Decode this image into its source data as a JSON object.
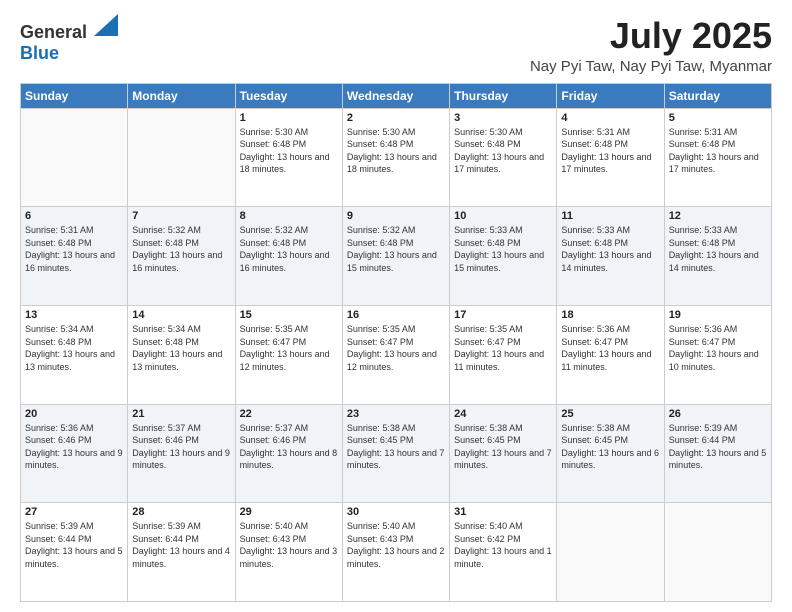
{
  "header": {
    "logo_general": "General",
    "logo_blue": "Blue",
    "month": "July 2025",
    "location": "Nay Pyi Taw, Nay Pyi Taw, Myanmar"
  },
  "weekdays": [
    "Sunday",
    "Monday",
    "Tuesday",
    "Wednesday",
    "Thursday",
    "Friday",
    "Saturday"
  ],
  "weeks": [
    [
      {
        "day": "",
        "sunrise": "",
        "sunset": "",
        "daylight": ""
      },
      {
        "day": "",
        "sunrise": "",
        "sunset": "",
        "daylight": ""
      },
      {
        "day": "1",
        "sunrise": "Sunrise: 5:30 AM",
        "sunset": "Sunset: 6:48 PM",
        "daylight": "Daylight: 13 hours and 18 minutes."
      },
      {
        "day": "2",
        "sunrise": "Sunrise: 5:30 AM",
        "sunset": "Sunset: 6:48 PM",
        "daylight": "Daylight: 13 hours and 18 minutes."
      },
      {
        "day": "3",
        "sunrise": "Sunrise: 5:30 AM",
        "sunset": "Sunset: 6:48 PM",
        "daylight": "Daylight: 13 hours and 17 minutes."
      },
      {
        "day": "4",
        "sunrise": "Sunrise: 5:31 AM",
        "sunset": "Sunset: 6:48 PM",
        "daylight": "Daylight: 13 hours and 17 minutes."
      },
      {
        "day": "5",
        "sunrise": "Sunrise: 5:31 AM",
        "sunset": "Sunset: 6:48 PM",
        "daylight": "Daylight: 13 hours and 17 minutes."
      }
    ],
    [
      {
        "day": "6",
        "sunrise": "Sunrise: 5:31 AM",
        "sunset": "Sunset: 6:48 PM",
        "daylight": "Daylight: 13 hours and 16 minutes."
      },
      {
        "day": "7",
        "sunrise": "Sunrise: 5:32 AM",
        "sunset": "Sunset: 6:48 PM",
        "daylight": "Daylight: 13 hours and 16 minutes."
      },
      {
        "day": "8",
        "sunrise": "Sunrise: 5:32 AM",
        "sunset": "Sunset: 6:48 PM",
        "daylight": "Daylight: 13 hours and 16 minutes."
      },
      {
        "day": "9",
        "sunrise": "Sunrise: 5:32 AM",
        "sunset": "Sunset: 6:48 PM",
        "daylight": "Daylight: 13 hours and 15 minutes."
      },
      {
        "day": "10",
        "sunrise": "Sunrise: 5:33 AM",
        "sunset": "Sunset: 6:48 PM",
        "daylight": "Daylight: 13 hours and 15 minutes."
      },
      {
        "day": "11",
        "sunrise": "Sunrise: 5:33 AM",
        "sunset": "Sunset: 6:48 PM",
        "daylight": "Daylight: 13 hours and 14 minutes."
      },
      {
        "day": "12",
        "sunrise": "Sunrise: 5:33 AM",
        "sunset": "Sunset: 6:48 PM",
        "daylight": "Daylight: 13 hours and 14 minutes."
      }
    ],
    [
      {
        "day": "13",
        "sunrise": "Sunrise: 5:34 AM",
        "sunset": "Sunset: 6:48 PM",
        "daylight": "Daylight: 13 hours and 13 minutes."
      },
      {
        "day": "14",
        "sunrise": "Sunrise: 5:34 AM",
        "sunset": "Sunset: 6:48 PM",
        "daylight": "Daylight: 13 hours and 13 minutes."
      },
      {
        "day": "15",
        "sunrise": "Sunrise: 5:35 AM",
        "sunset": "Sunset: 6:47 PM",
        "daylight": "Daylight: 13 hours and 12 minutes."
      },
      {
        "day": "16",
        "sunrise": "Sunrise: 5:35 AM",
        "sunset": "Sunset: 6:47 PM",
        "daylight": "Daylight: 13 hours and 12 minutes."
      },
      {
        "day": "17",
        "sunrise": "Sunrise: 5:35 AM",
        "sunset": "Sunset: 6:47 PM",
        "daylight": "Daylight: 13 hours and 11 minutes."
      },
      {
        "day": "18",
        "sunrise": "Sunrise: 5:36 AM",
        "sunset": "Sunset: 6:47 PM",
        "daylight": "Daylight: 13 hours and 11 minutes."
      },
      {
        "day": "19",
        "sunrise": "Sunrise: 5:36 AM",
        "sunset": "Sunset: 6:47 PM",
        "daylight": "Daylight: 13 hours and 10 minutes."
      }
    ],
    [
      {
        "day": "20",
        "sunrise": "Sunrise: 5:36 AM",
        "sunset": "Sunset: 6:46 PM",
        "daylight": "Daylight: 13 hours and 9 minutes."
      },
      {
        "day": "21",
        "sunrise": "Sunrise: 5:37 AM",
        "sunset": "Sunset: 6:46 PM",
        "daylight": "Daylight: 13 hours and 9 minutes."
      },
      {
        "day": "22",
        "sunrise": "Sunrise: 5:37 AM",
        "sunset": "Sunset: 6:46 PM",
        "daylight": "Daylight: 13 hours and 8 minutes."
      },
      {
        "day": "23",
        "sunrise": "Sunrise: 5:38 AM",
        "sunset": "Sunset: 6:45 PM",
        "daylight": "Daylight: 13 hours and 7 minutes."
      },
      {
        "day": "24",
        "sunrise": "Sunrise: 5:38 AM",
        "sunset": "Sunset: 6:45 PM",
        "daylight": "Daylight: 13 hours and 7 minutes."
      },
      {
        "day": "25",
        "sunrise": "Sunrise: 5:38 AM",
        "sunset": "Sunset: 6:45 PM",
        "daylight": "Daylight: 13 hours and 6 minutes."
      },
      {
        "day": "26",
        "sunrise": "Sunrise: 5:39 AM",
        "sunset": "Sunset: 6:44 PM",
        "daylight": "Daylight: 13 hours and 5 minutes."
      }
    ],
    [
      {
        "day": "27",
        "sunrise": "Sunrise: 5:39 AM",
        "sunset": "Sunset: 6:44 PM",
        "daylight": "Daylight: 13 hours and 5 minutes."
      },
      {
        "day": "28",
        "sunrise": "Sunrise: 5:39 AM",
        "sunset": "Sunset: 6:44 PM",
        "daylight": "Daylight: 13 hours and 4 minutes."
      },
      {
        "day": "29",
        "sunrise": "Sunrise: 5:40 AM",
        "sunset": "Sunset: 6:43 PM",
        "daylight": "Daylight: 13 hours and 3 minutes."
      },
      {
        "day": "30",
        "sunrise": "Sunrise: 5:40 AM",
        "sunset": "Sunset: 6:43 PM",
        "daylight": "Daylight: 13 hours and 2 minutes."
      },
      {
        "day": "31",
        "sunrise": "Sunrise: 5:40 AM",
        "sunset": "Sunset: 6:42 PM",
        "daylight": "Daylight: 13 hours and 1 minute."
      },
      {
        "day": "",
        "sunrise": "",
        "sunset": "",
        "daylight": ""
      },
      {
        "day": "",
        "sunrise": "",
        "sunset": "",
        "daylight": ""
      }
    ]
  ]
}
